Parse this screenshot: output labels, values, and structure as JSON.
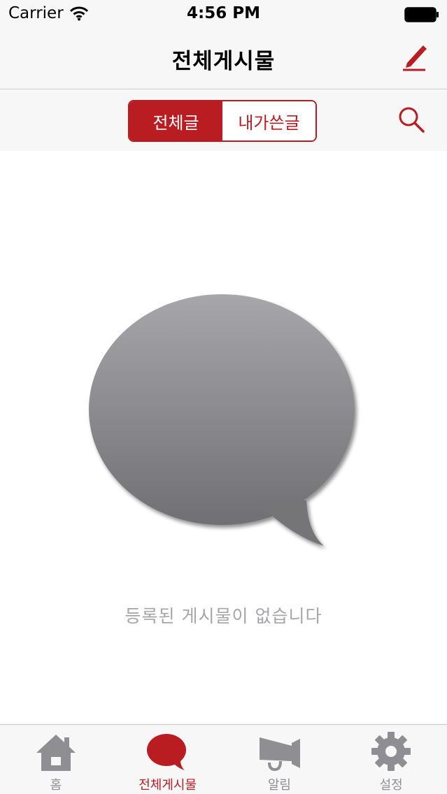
{
  "status_bar": {
    "carrier": "Carrier",
    "time": "4:56 PM"
  },
  "nav": {
    "title": "전체게시물",
    "compose_icon": "pencil-icon"
  },
  "filter": {
    "segments": [
      {
        "label": "전체글",
        "selected": true
      },
      {
        "label": "내가쓴글",
        "selected": false
      }
    ],
    "search_icon": "search-icon"
  },
  "empty_state": {
    "icon": "speech-bubble-icon",
    "message": "등록된 게시물이 없습니다"
  },
  "tabs": [
    {
      "label": "홈",
      "icon": "home-icon",
      "selected": false
    },
    {
      "label": "전체게시물",
      "icon": "speech-bubble-icon",
      "selected": true
    },
    {
      "label": "알림",
      "icon": "megaphone-icon",
      "selected": false
    },
    {
      "label": "설정",
      "icon": "gear-icon",
      "selected": false
    }
  ],
  "colors": {
    "accent": "#b91d22",
    "inactive": "#8e8e93",
    "empty_text": "#a6a6aa",
    "bar_background": "#f7f7f7"
  }
}
